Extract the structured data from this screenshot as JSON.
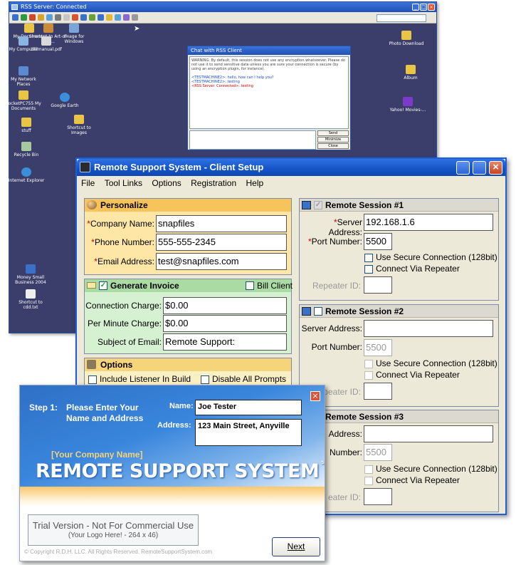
{
  "rss_window": {
    "title": "RSS Server: Connected",
    "desktop_icons": [
      {
        "label": "My Documents",
        "icon": "folder-icon"
      },
      {
        "label": "Shortcut to Art-of-Raw...",
        "icon": "shortcut-icon"
      },
      {
        "label": "Image for Windows",
        "icon": "image-icon"
      },
      {
        "label": "My Computer",
        "icon": "computer-icon"
      },
      {
        "label": "LFilmanual.pdf",
        "icon": "pdf-icon"
      },
      {
        "label": "My Network Places",
        "icon": "network-icon"
      },
      {
        "label": "PocketPC755 My Documents",
        "icon": "folder-icon"
      },
      {
        "label": "Google Earth",
        "icon": "globe-icon"
      },
      {
        "label": "stuff",
        "icon": "folder-icon"
      },
      {
        "label": "Shortcut to Images",
        "icon": "folder-icon"
      },
      {
        "label": "Recycle Bin",
        "icon": "recycle-bin-icon"
      },
      {
        "label": "Internet Explorer",
        "icon": "browser-icon"
      },
      {
        "label": "Money Small Business 2004",
        "icon": "money-icon"
      },
      {
        "label": "Shortcut to cdd.txt",
        "icon": "text-file-icon"
      },
      {
        "label": "Photo Download",
        "icon": "folder-icon"
      },
      {
        "label": "Album",
        "icon": "folder-icon"
      },
      {
        "label": "Yahoo! Movies-...",
        "icon": "yahoo-icon"
      }
    ]
  },
  "chat_window": {
    "title": "Chat with RSS Client",
    "warning": "WARNING: By default, this session does not use any encryption whatsoever. Please do not use it to send sensitive data unless you are sure your connection is secure (by using an encryption plugin, for instance).",
    "messages": [
      "<TESTMACHINE2>: hello, how can I help you?",
      "<TESTMACHINE2>: testing",
      "<RSS Server: Connected>: testing"
    ],
    "buttons": {
      "send": "Send",
      "minimize": "Minimize",
      "close": "Close"
    }
  },
  "setup_window": {
    "title": "Remote Support System - Client Setup",
    "menu": [
      "File",
      "Tool Links",
      "Options",
      "Registration",
      "Help"
    ],
    "personalize": {
      "header": "Personalize",
      "company_label": "Company Name:",
      "company_value": "snapfiles",
      "phone_label": "Phone Number:",
      "phone_value": "555-555-2345",
      "email_label": "Email Address:",
      "email_value": "test@snapfiles.com"
    },
    "invoice": {
      "header": "Generate Invoice",
      "bill_client": "Bill Client",
      "connection_label": "Connection Charge:",
      "connection_value": "$0.00",
      "per_minute_label": "Per Minute Charge:",
      "per_minute_value": "$0.00",
      "subject_label": "Subject of Email:",
      "subject_value": "Remote Support:"
    },
    "options": {
      "header": "Options",
      "items": [
        "Include Listener In Build",
        "Disable All Prompts"
      ]
    },
    "sessions": [
      {
        "header": "Remote Session #1",
        "server_label": "Server Address:",
        "server_value": "192.168.1.6",
        "port_label": "Port Number:",
        "port_value": "5500",
        "secure": "Use Secure Connection (128bit)",
        "repeater": "Connect Via Repeater",
        "repeater_id": "Repeater ID:"
      },
      {
        "header": "Remote Session #2",
        "server_label": "Server Address:",
        "server_value": "",
        "port_label": "Port Number:",
        "port_value": "5500",
        "secure": "Use Secure Connection (128bit)",
        "repeater": "Connect Via Repeater",
        "repeater_id": "Repeater ID:"
      },
      {
        "header": "Remote Session #3",
        "server_label": "Address:",
        "server_value": "",
        "port_label": "Number:",
        "port_value": "5500",
        "secure": "Use Secure Connection (128bit)",
        "repeater": "Connect Via Repeater",
        "repeater_id": "eater ID:"
      }
    ]
  },
  "wizard": {
    "step": "Step 1:",
    "instruction_line1": "Please Enter Your",
    "instruction_line2": "Name and Address",
    "name_label": "Name:",
    "name_value": "Joe Tester",
    "address_label": "Address:",
    "address_value": "123 Main Street, Anyville",
    "company_placeholder": "[Your Company Name]",
    "brand": "REMOTE SUPPORT SYSTEM",
    "brand_mark": "SM",
    "trial_line1": "Trial Version - Not For Commercial Use",
    "trial_line2": "(Your Logo Here! - 264 x 46)",
    "copyright": "© Copyright R.D.H. LLC.  All Rights Reserved.  RemoteSupportSystem.com",
    "next_button": "Next",
    "close_icon": "close-icon"
  }
}
